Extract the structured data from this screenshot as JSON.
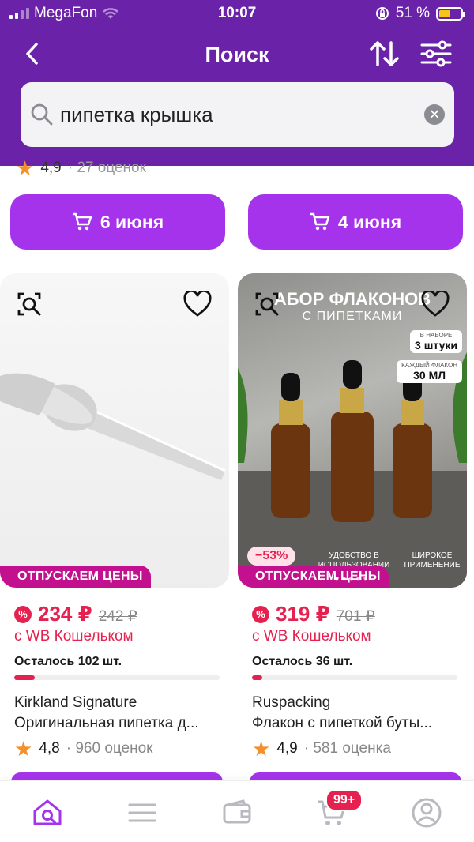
{
  "status_bar": {
    "carrier": "MegaFon",
    "time": "10:07",
    "battery": "51 %"
  },
  "nav": {
    "title": "Поиск"
  },
  "search": {
    "query": "пипетка крышка"
  },
  "prev_row": {
    "rating_left": {
      "value": "4,9",
      "count": "· 27 оценок"
    },
    "buttons": [
      {
        "label": "6 июня"
      },
      {
        "label": "4 июня"
      }
    ]
  },
  "products": [
    {
      "promo_label": "ОТПУСКАЕМ ЦЕНЫ",
      "price": "234 ₽",
      "old_price": "242 ₽",
      "wallet_text": "с WB Кошельком",
      "remaining": "Осталось 102 шт.",
      "stock_level": 0.1,
      "brand": "Kirkland Signature",
      "name": "Оригинальная пипетка д...",
      "rating": "4,8",
      "rating_count": "· 960 оценок"
    },
    {
      "promo_label": "ОТПУСКАЕМ ЦЕНЫ",
      "discount": "−53%",
      "price": "319 ₽",
      "old_price": "701 ₽",
      "wallet_text": "с WB Кошельком",
      "remaining": "Осталось 36 шт.",
      "stock_level": 0.05,
      "brand": "Ruspacking",
      "name": "Флакон с пипеткой буты...",
      "rating": "4,9",
      "rating_count": "· 581 оценка",
      "image_text": {
        "title": "АБОР ФЛАКОНОВ",
        "subtitle": "С ПИПЕТКАМИ",
        "set_small": "В НАБОРЕ",
        "set_big": "3 штуки",
        "vol_small": "КАЖДЫЙ ФЛАКОН",
        "vol_big": "30 МЛ",
        "feature1": "УДОБСТВО В ИСПОЛЬЗОВАНИИ",
        "feature2": "ШИРОКОЕ ПРИМЕНЕНИЕ"
      }
    }
  ],
  "tabbar": {
    "cart_badge": "99+"
  },
  "colors": {
    "header": "#6a22a8",
    "accent": "#a633ec",
    "price": "#e5214f",
    "promo": "#c3108f"
  }
}
